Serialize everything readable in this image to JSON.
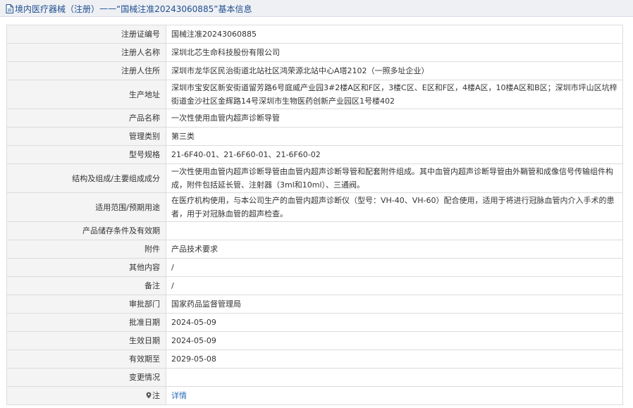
{
  "header": {
    "breadcrumb_prefix": "境内医疗器械（注册）",
    "separator": " —— ",
    "record_title": "“国械注准20243060885”",
    "suffix": " 基本信息"
  },
  "rows": [
    {
      "label": "注册证编号",
      "value": "国械注准20243060885"
    },
    {
      "label": "注册人名称",
      "value": "深圳北芯生命科技股份有限公司"
    },
    {
      "label": "注册人住所",
      "value": "深圳市龙华区民治街道北站社区鸿荣源北站中心A塔2102（一照多址企业）"
    },
    {
      "label": "生产地址",
      "value": "深圳市宝安区新安街道留芳路6号庭威产业园3#2楼A区和F区，3楼C区、E区和F区，4楼A区，10楼A区和B区；深圳市坪山区坑梓街道金沙社区金辉路14号深圳市生物医药创新产业园区1号楼402"
    },
    {
      "label": "产品名称",
      "value": "一次性使用血管内超声诊断导管"
    },
    {
      "label": "管理类别",
      "value": "第三类"
    },
    {
      "label": "型号规格",
      "value": "21-6F40-01、21-6F60-01、21-6F60-02"
    },
    {
      "label": "结构及组成/主要组成成分",
      "value": "一次性使用血管内超声诊断导管由血管内超声诊断导管和配套附件组成。其中血管内超声诊断导管由外鞘管和成像信号传输组件构成，附件包括延长管、注射器（3ml和10ml）、三通阀。"
    },
    {
      "label": "适用范围/预期用途",
      "value": "在医疗机构使用，与本公司生产的血管内超声诊断仪（型号：VH-40、VH-60）配合使用，适用于将进行冠脉血管内介入手术的患者，用于对冠脉血管的超声检查。"
    },
    {
      "label": "产品储存条件及有效期",
      "value": ""
    },
    {
      "label": "附件",
      "value": "产品技术要求"
    },
    {
      "label": "其他内容",
      "value": "/"
    },
    {
      "label": "备注",
      "value": "/"
    },
    {
      "label": "审批部门",
      "value": "国家药品监督管理局"
    },
    {
      "label": "批准日期",
      "value": "2024-05-09"
    },
    {
      "label": "生效日期",
      "value": "2024-05-09"
    },
    {
      "label": "有效期至",
      "value": "2029-05-08"
    },
    {
      "label": "变更情况",
      "value": ""
    }
  ],
  "note_row": {
    "label": "注",
    "link_text": "详情"
  },
  "colors": {
    "header_text": "#1f4e8f",
    "link": "#2b6cb8",
    "label_bg": "#f4f4f4",
    "border": "#dcdcdc"
  }
}
